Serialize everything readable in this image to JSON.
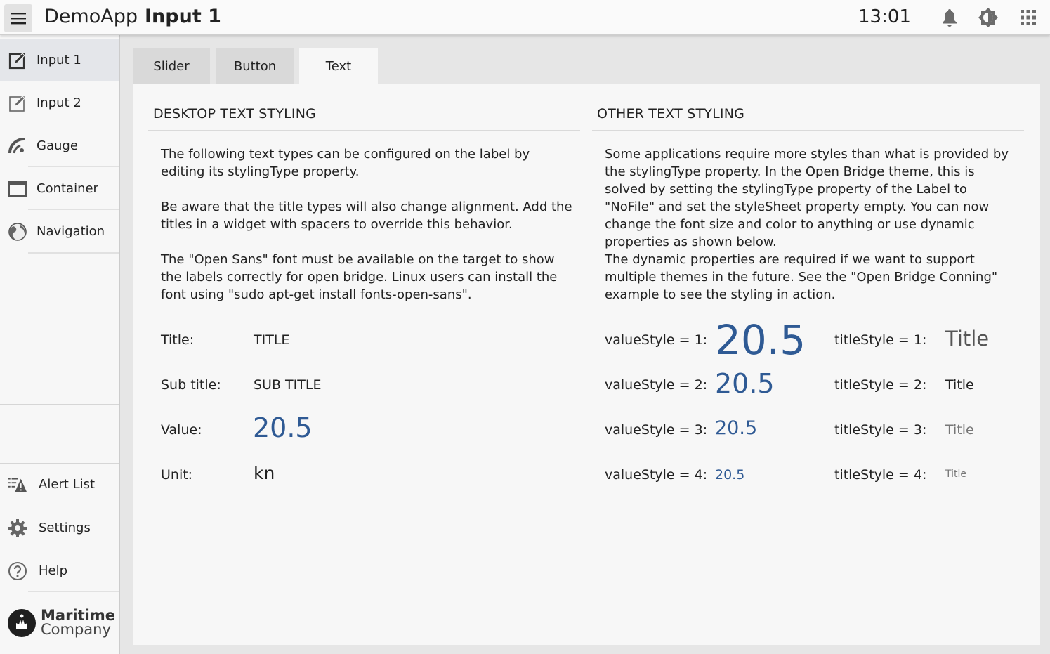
{
  "topbar": {
    "app_name": "DemoApp",
    "page_name": "Input 1",
    "clock": "13:01",
    "icons": [
      "menu-icon",
      "bell-icon",
      "brightness-icon",
      "apps-grid-icon"
    ]
  },
  "sidebar": {
    "items": [
      {
        "label": "Input 1",
        "icon": "edit-icon",
        "active": true
      },
      {
        "label": "Input 2",
        "icon": "edit-icon",
        "active": false
      },
      {
        "label": "Gauge",
        "icon": "gauge-icon",
        "active": false
      },
      {
        "label": "Container",
        "icon": "window-icon",
        "active": false
      },
      {
        "label": "Navigation",
        "icon": "globe-icon",
        "active": false
      }
    ],
    "bottom_items": [
      {
        "label": "Alert List",
        "icon": "alert-list-icon"
      },
      {
        "label": "Settings",
        "icon": "gear-icon"
      },
      {
        "label": "Help",
        "icon": "help-icon"
      }
    ],
    "logo": {
      "line1": "Maritime",
      "line2": "Company"
    }
  },
  "tabs": [
    {
      "label": "Slider",
      "active": false
    },
    {
      "label": "Button",
      "active": false
    },
    {
      "label": "Text",
      "active": true
    }
  ],
  "left_section": {
    "title": "DESKTOP TEXT STYLING",
    "paragraphs": [
      "The following text types can be configured on the label by editing its stylingType property.",
      "Be aware that the title types will also change alignment. Add the titles in a widget with spacers to override this behavior.",
      "The \"Open Sans\" font must be available on the target to show the labels correctly for open bridge. Linux users can install the font using \"sudo apt-get install fonts-open-sans\"."
    ],
    "rows": [
      {
        "label": "Title:",
        "value": "TITLE"
      },
      {
        "label": "Sub title:",
        "value": "SUB TITLE"
      },
      {
        "label": "Value:",
        "value": "20.5"
      },
      {
        "label": "Unit:",
        "value": "kn"
      }
    ]
  },
  "right_section": {
    "title": "OTHER TEXT STYLING",
    "paragraphs": [
      "Some applications require more styles than what is provided by the stylingType property. In the Open Bridge theme, this is solved by setting the stylingType property of the Label to \"NoFile\" and set the styleSheet property empty. You can now change the font size and color to anything or use dynamic properties as shown below.",
      "The dynamic properties are required if we want to support multiple themes in the future. See the \"Open Bridge Conning\" example  to see the styling in action."
    ],
    "value_rows": [
      {
        "label": "valueStyle = 1:",
        "value": "20.5"
      },
      {
        "label": "valueStyle = 2:",
        "value": "20.5"
      },
      {
        "label": "valueStyle = 3:",
        "value": "20.5"
      },
      {
        "label": "valueStyle = 4:",
        "value": "20.5"
      }
    ],
    "title_rows": [
      {
        "label": "titleStyle = 1:",
        "value": "Title"
      },
      {
        "label": "titleStyle = 2:",
        "value": "Title"
      },
      {
        "label": "titleStyle = 3:",
        "value": "Title"
      },
      {
        "label": "titleStyle = 4:",
        "value": "Title"
      }
    ]
  },
  "colors": {
    "accent": "#2f5a94",
    "active_nav": "#e4e6ea",
    "panel": "#f7f7f7"
  }
}
